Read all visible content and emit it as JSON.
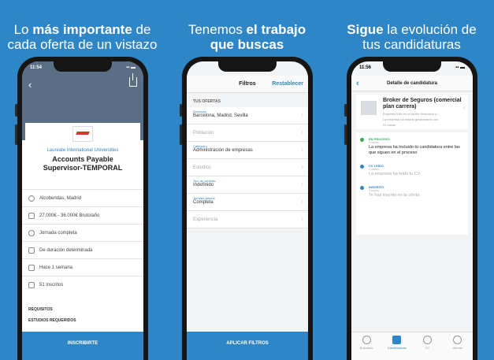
{
  "panels": [
    {
      "headline_parts": [
        "Lo ",
        "más importante",
        " de",
        "cada oferta de un vistazo"
      ],
      "status_time": "11:54",
      "company": "Laureate International Universities",
      "job_title_line1": "Accounts Payable",
      "job_title_line2": "Supervisor-TEMPORAL",
      "rows": [
        {
          "icon": "location-icon",
          "text": "Alcobendas, Madrid"
        },
        {
          "icon": "salary-icon",
          "text": "27.000€ - 36.000€ Bruto/año"
        },
        {
          "icon": "clock-icon",
          "text": "Jornada completa"
        },
        {
          "icon": "contract-icon",
          "text": "De duración determinada"
        },
        {
          "icon": "calendar-icon",
          "text": "Hace 1 semana"
        },
        {
          "icon": "applicants-icon",
          "text": "51 inscritos"
        }
      ],
      "requirements_label": "REQUISITOS",
      "studies_label": "ESTUDIOS REQUERIDOS",
      "cta": "INSCRIBIRTE"
    },
    {
      "headline_parts": [
        "Tenemos ",
        "el trabajo",
        "que buscas"
      ],
      "nav_title": "Filtros",
      "reset_label": "Restablecer",
      "section_label": "TUS OFERTAS",
      "filters": [
        {
          "small": "Provincia",
          "value": "Barcelona, Madrid, Sevilla",
          "placeholder": ""
        },
        {
          "small": "",
          "value": "",
          "placeholder": "Población"
        },
        {
          "small": "Categoría",
          "value": "Administración de empresas",
          "placeholder": ""
        },
        {
          "small": "",
          "value": "",
          "placeholder": "Estudios"
        },
        {
          "small": "Tipo de contrato",
          "value": "Indefinido",
          "placeholder": ""
        },
        {
          "small": "Jornada laboral",
          "value": "Completa",
          "placeholder": ""
        },
        {
          "small": "",
          "value": "",
          "placeholder": "Experiencia"
        }
      ],
      "cta": "APLICAR FILTROS"
    },
    {
      "headline_parts": [
        "Sigue",
        " la evolución de",
        "tus candidaturas"
      ],
      "status_time": "11:56",
      "nav_title": "Detalle de candidatura",
      "job_title": "Broker de Seguros (comercial plan carrera)",
      "job_sub": "Empresa líder en el sector financiero y...",
      "job_sub2": "La empresa ha estado gestionando con",
      "job_sub3": "21 vacan.",
      "steps": [
        {
          "label": "EN PROCESO",
          "date": "8 marzo",
          "desc": "La empresa ha incluido tu candidatura entre las que siguen en el proceso",
          "color": "#3aa757",
          "muted": false
        },
        {
          "label": "CV LEÍDO",
          "date": "4 marzo",
          "desc": "La empresa ha leído tu CV",
          "color": "#2e86c7",
          "muted": true
        },
        {
          "label": "INSCRITO",
          "date": "3 marzo",
          "desc": "Te has inscrito en la oferta",
          "color": "#2e86c7",
          "muted": true
        }
      ],
      "tabs": [
        {
          "label": "Buscador",
          "active": false
        },
        {
          "label": "Candidaturas",
          "active": true
        },
        {
          "label": "CV",
          "active": false
        },
        {
          "label": "Alertas",
          "active": false
        }
      ]
    }
  ]
}
